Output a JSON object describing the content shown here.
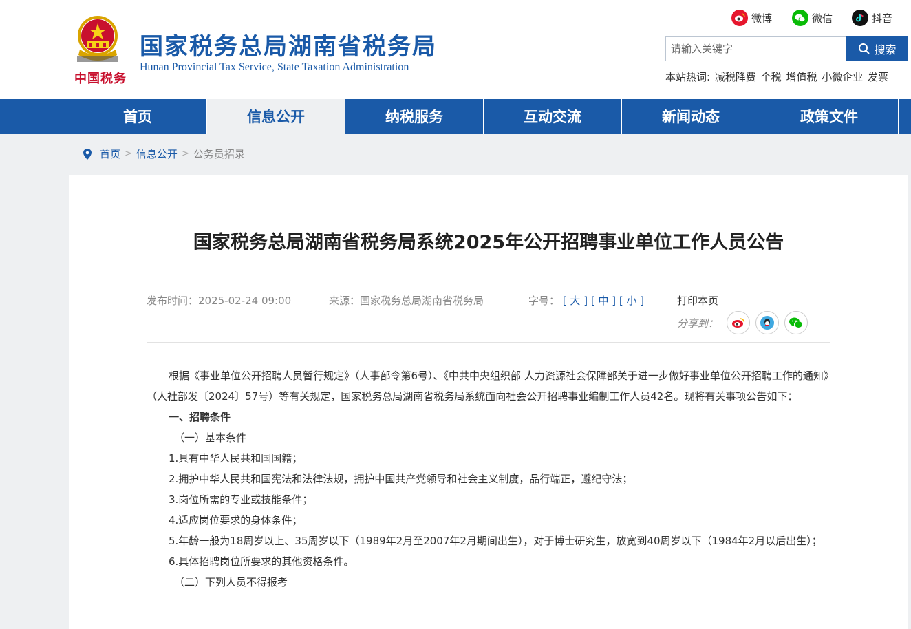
{
  "header": {
    "title": "国家税务总局湖南省税务局",
    "subtitle": "Hunan Provincial  Tax Service,  State Taxation Administration",
    "emblem_text": "中国税务",
    "social": [
      {
        "label": "微博",
        "icon": "weibo-icon",
        "color": "#e6162d"
      },
      {
        "label": "微信",
        "icon": "wechat-icon",
        "color": "#09bb07"
      },
      {
        "label": "抖音",
        "icon": "douyin-icon",
        "color": "#111111"
      }
    ],
    "search": {
      "placeholder": "请输入关键字",
      "button": "搜索"
    },
    "hot": {
      "label": "本站热词:",
      "words": [
        "减税降费",
        "个税",
        "增值税",
        "小微企业",
        "发票"
      ]
    }
  },
  "nav": {
    "items": [
      "首页",
      "信息公开",
      "纳税服务",
      "互动交流",
      "新闻动态",
      "政策文件"
    ],
    "active_index": 1
  },
  "breadcrumb": [
    "首页",
    "信息公开",
    "公务员招录"
  ],
  "article": {
    "title": "国家税务总局湖南省税务局系统2025年公开招聘事业单位工作人员公告",
    "publish": "发布时间：2025-02-24 09:00",
    "source": "来源：国家税务总局湖南省税务局",
    "fontsize_label": "字号：",
    "font_large": "大",
    "font_medium": "中",
    "font_small": "小",
    "print": "打印本页",
    "share_label": "分享到：",
    "paragraphs": [
      "根据《事业单位公开招聘人员暂行规定》（人事部令第6号）、《中共中央组织部 人力资源社会保障部关于进一步做好事业单位公开招聘工作的通知》（人社部发〔2024〕57号）等有关规定，国家税务总局湖南省税务局系统面向社会公开招聘事业编制工作人员42名。现将有关事项公告如下：",
      "一、招聘条件",
      "（一）基本条件",
      "1.具有中华人民共和国国籍；",
      "2.拥护中华人民共和国宪法和法律法规，拥护中国共产党领导和社会主义制度，品行端正，遵纪守法；",
      "3.岗位所需的专业或技能条件；",
      "4.适应岗位要求的身体条件；",
      "5.年龄一般为18周岁以上、35周岁以下（1989年2月至2007年2月期间出生），对于博士研究生，放宽到40周岁以下（1984年2月以后出生）；",
      "6.具体招聘岗位所要求的其他资格条件。",
      "（二）下列人员不得报考"
    ]
  },
  "colors": {
    "primary": "#1a5aa8",
    "background": "#eef0f2"
  }
}
